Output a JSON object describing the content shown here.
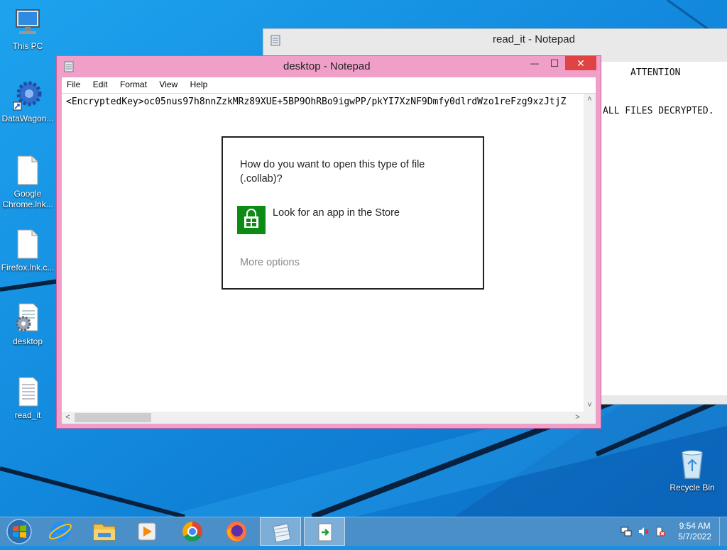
{
  "desktop": {
    "icons": [
      {
        "label": "This PC",
        "icon": "computer-icon"
      },
      {
        "label": "DataWagon...",
        "icon": "gear-shortcut-icon"
      },
      {
        "label": "Google Chrome.lnk...",
        "icon": "document-icon"
      },
      {
        "label": "Firefox.lnk.c...",
        "icon": "document-icon"
      },
      {
        "label": "desktop",
        "icon": "text-file-gear-icon"
      },
      {
        "label": "read_it",
        "icon": "text-file-icon"
      },
      {
        "label": "Recycle Bin",
        "icon": "recycle-bin-icon"
      }
    ]
  },
  "back_window": {
    "title": "read_it - Notepad",
    "line1": "ATTENTION",
    "line2": "ALL FILES DECRYPTED."
  },
  "front_window": {
    "title": "desktop - Notepad",
    "menu": [
      "File",
      "Edit",
      "Format",
      "View",
      "Help"
    ],
    "content": "<EncryptedKey>oc05nus97h8nnZzkMRz89XUE+5BP9OhRBo9igwPP/pkYI7XzNF9Dmfy0dlrdWzo1reFzg9xzJtjZ",
    "buttons": {
      "minimize": "—",
      "maximize": "☐",
      "close": "✕"
    }
  },
  "dialog": {
    "question": "How do you want to open this type of file (.collab)?",
    "store_option": "Look for an app in the Store",
    "more_options": "More options"
  },
  "taskbar": {
    "apps": [
      "start-button",
      "internet-explorer-icon",
      "file-explorer-icon",
      "media-player-icon",
      "chrome-icon",
      "firefox-icon",
      "notepad-icon",
      "app-icon"
    ],
    "clock_time": "9:54 AM",
    "clock_date": "5/7/2022"
  },
  "colors": {
    "desktop_blue": "#1a8fe0",
    "window_accent": "#f0a0c8",
    "close_red": "#e04343",
    "store_green": "#0e8a16",
    "taskbar": "#4a8fc8"
  }
}
